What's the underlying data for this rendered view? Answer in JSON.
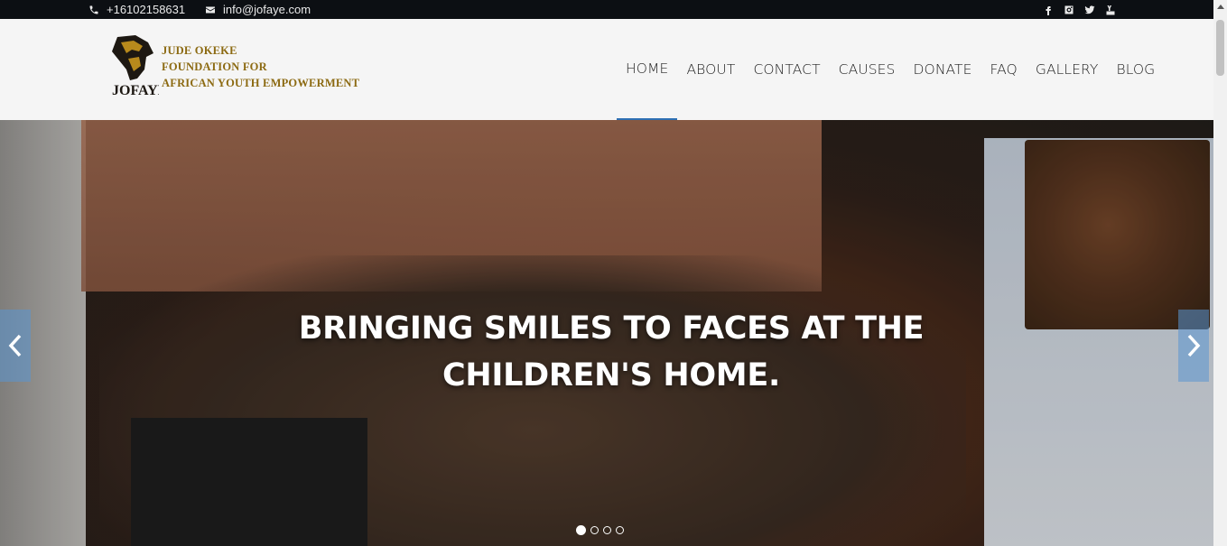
{
  "topbar": {
    "phone": "+16102158631",
    "email": "info@jofaye.com",
    "social": [
      "facebook-icon",
      "instagram-icon",
      "twitter-icon",
      "youtube-icon"
    ]
  },
  "logo": {
    "mark_text": "JOFAYE",
    "lines": [
      "JUDE OKEKE",
      "FOUNDATION FOR",
      "AFRICAN YOUTH EMPOWERMENT"
    ]
  },
  "nav": {
    "items": [
      "HOME",
      "ABOUT",
      "CONTACT",
      "CAUSES",
      "DONATE",
      "FAQ",
      "GALLERY",
      "BLOG"
    ],
    "active": "HOME"
  },
  "hero": {
    "caption_line1": "BRINGING SMILES TO FACES AT THE",
    "caption_line2": "CHILDREN'S HOME.",
    "slides": 4,
    "current_slide": 1
  },
  "colors": {
    "topbar_bg": "#0c0f13",
    "header_bg": "#f5f5f5",
    "logo_gold": "#8c6a12",
    "nav_active_underline": "#2e6fb3",
    "arrow_bg": "#5a96d2"
  }
}
